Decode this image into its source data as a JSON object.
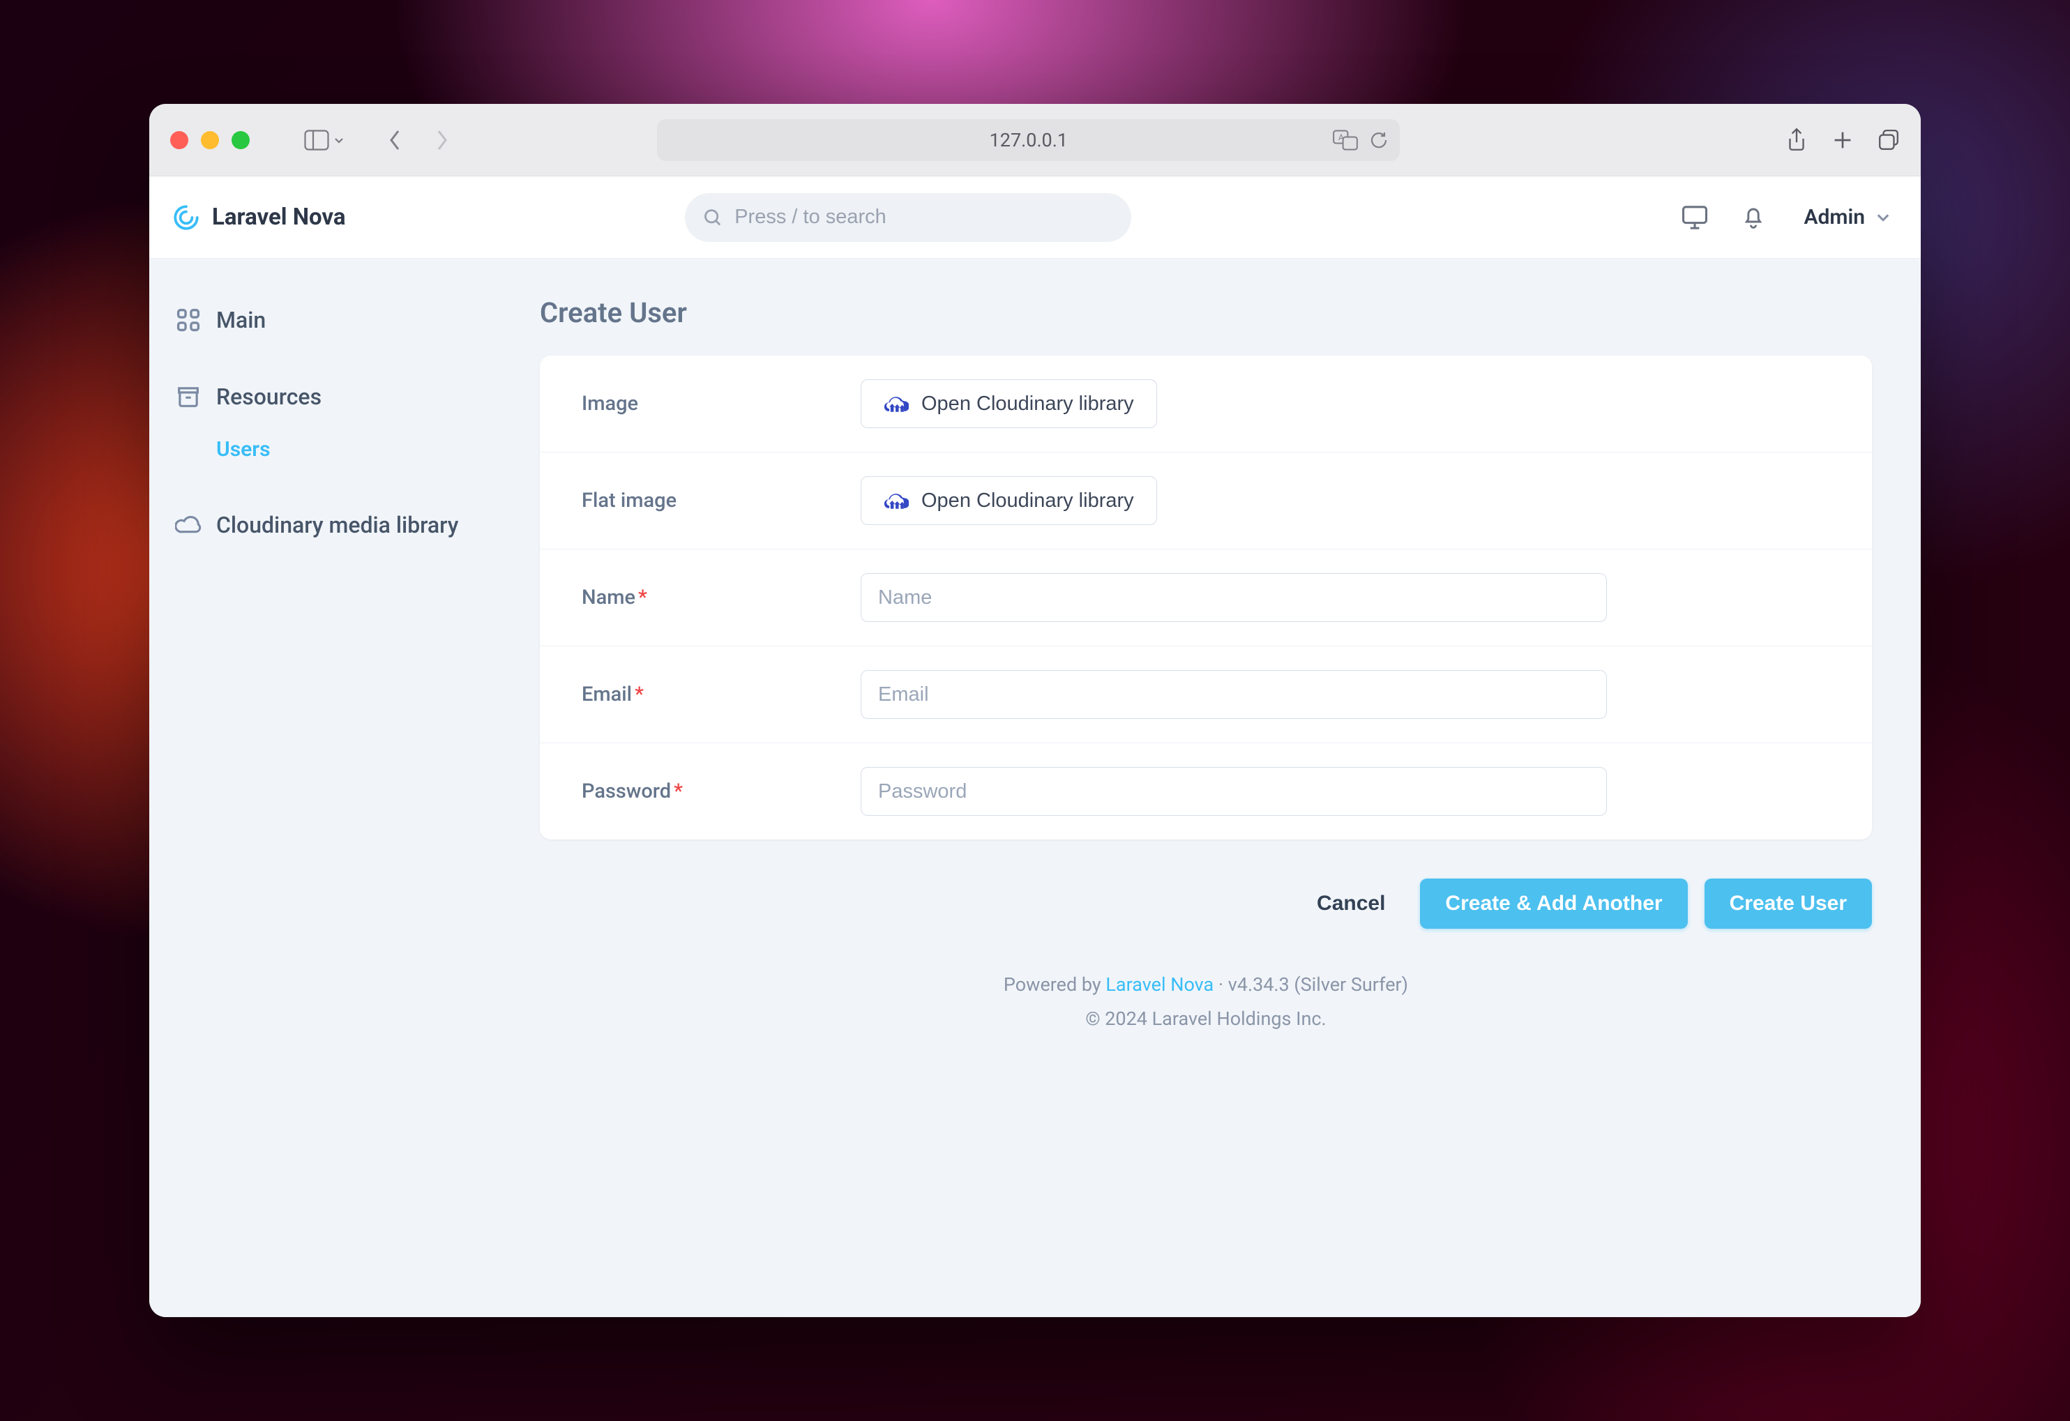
{
  "browser": {
    "address": "127.0.0.1"
  },
  "header": {
    "brand": "Laravel Nova",
    "search_placeholder": "Press / to search",
    "user": "Admin"
  },
  "sidebar": {
    "main": "Main",
    "resources": "Resources",
    "users": "Users",
    "cloudinary": "Cloudinary media library"
  },
  "page": {
    "title": "Create User",
    "fields": {
      "image": {
        "label": "Image",
        "button": "Open Cloudinary library"
      },
      "flat_image": {
        "label": "Flat image",
        "button": "Open Cloudinary library"
      },
      "name": {
        "label": "Name",
        "required": true,
        "placeholder": "Name"
      },
      "email": {
        "label": "Email",
        "required": true,
        "placeholder": "Email"
      },
      "password": {
        "label": "Password",
        "required": true,
        "placeholder": "Password"
      }
    },
    "actions": {
      "cancel": "Cancel",
      "create_another": "Create & Add Another",
      "create": "Create User"
    }
  },
  "footer": {
    "powered_by_prefix": "Powered by ",
    "nova_link": "Laravel Nova",
    "version_suffix": " · v4.34.3 (Silver Surfer)",
    "copyright": "© 2024 Laravel Holdings Inc."
  }
}
